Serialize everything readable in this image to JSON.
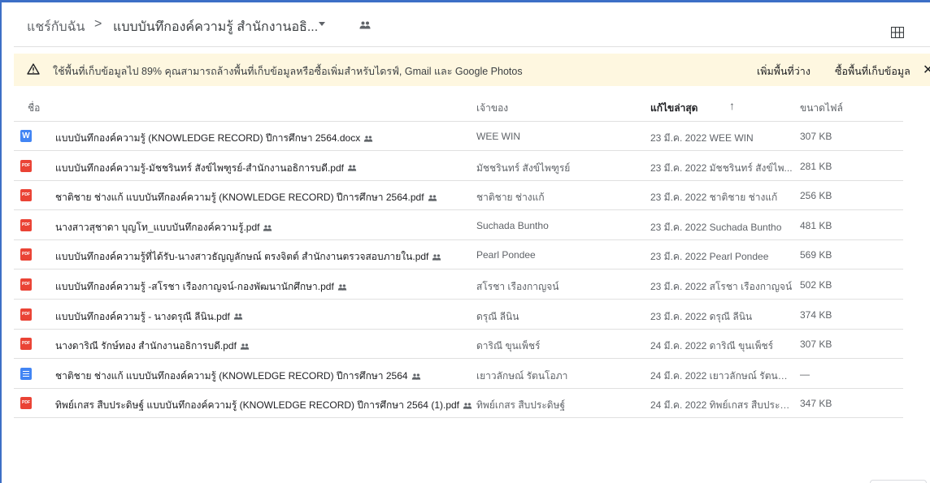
{
  "breadcrumb": {
    "root": "แชร์กับฉัน",
    "separator": ">",
    "current": "แบบบันทึกองค์ความรู้ สำนักงานอธิ..."
  },
  "banner": {
    "icon": "warning-icon",
    "text": "ใช้พื้นที่เก็บข้อมูลไป 89% คุณสามารถล้างพื้นที่เก็บข้อมูลหรือซื้อเพิ่มสำหรับไดรฟ์, Gmail และ Google Photos",
    "free_up_label": "เพิ่มพื้นที่ว่าง",
    "buy_storage_label": "ซื้อพื้นที่เก็บข้อมูล",
    "close_glyph": "✕",
    "bg_color": "#fef7e0"
  },
  "columns": {
    "name": "ชื่อ",
    "owner": "เจ้าของ",
    "modified": "แก้ไขล่าสุด",
    "size": "ขนาดไฟล์",
    "sort_arrow": "↑"
  },
  "files": [
    {
      "type": "word",
      "name": "แบบบันทึกองค์ความรู้ (KNOWLEDGE RECORD) ปีการศึกษา 2564.docx",
      "owner": "WEE WIN",
      "modified": "23 มี.ค. 2022 WEE WIN",
      "size": "307 KB"
    },
    {
      "type": "pdf",
      "name": "แบบบันทึกองค์ความรู้-มัชชรินทร์ สังข์ไพฑูรย์-สำนักงานอธิการบดี.pdf",
      "owner": "มัชชรินทร์ สังข์ไพฑูรย์",
      "modified": "23 มี.ค. 2022 มัชชรินทร์ สังข์ไพ...",
      "size": "281 KB"
    },
    {
      "type": "pdf",
      "name": "ชาติชาย ช่างแก้ แบบบันทึกองค์ความรู้ (KNOWLEDGE RECORD) ปีการศึกษา 2564.pdf",
      "owner": "ชาติชาย ช่างแก้",
      "modified": "23 มี.ค. 2022 ชาติชาย ช่างแก้",
      "size": "256 KB"
    },
    {
      "type": "pdf",
      "name": "นางสาวสุชาดา บุญโท_แบบบันทึกองค์ความรู้.pdf",
      "owner": "Suchada Buntho",
      "modified": "23 มี.ค. 2022 Suchada Buntho",
      "size": "481 KB"
    },
    {
      "type": "pdf",
      "name": "แบบบันทึกองค์ความรู้ที่ได้รับ-นางสาวธัญญลักษณ์ ตรงจิตต์ สำนักงานตรวจสอบภายใน.pdf",
      "owner": "Pearl Pondee",
      "modified": "23 มี.ค. 2022 Pearl Pondee",
      "size": "569 KB"
    },
    {
      "type": "pdf",
      "name": "แบบบันทึกองค์ความรู้ -สโรชา เรืองกาญจน์-กองพัฒนานักศึกษา.pdf",
      "owner": "สโรชา เรืองกาญจน์",
      "modified": "23 มี.ค. 2022 สโรชา เรืองกาญจน์",
      "size": "502 KB"
    },
    {
      "type": "pdf",
      "name": "แบบบันทึกองค์ความรู้ - นางดรุณี ลีนิน.pdf",
      "owner": "ดรุณี ลีนิน",
      "modified": "23 มี.ค. 2022 ดรุณี ลีนิน",
      "size": "374 KB"
    },
    {
      "type": "pdf",
      "name": "นางดาริณี รักษ์ทอง สำนักงานอธิการบดี.pdf",
      "owner": "ดาริณี ขุนเพ็ชร์",
      "modified": "24 มี.ค. 2022 ดาริณี ขุนเพ็ชร์",
      "size": "307 KB"
    },
    {
      "type": "doc",
      "name": "ชาติชาย ช่างแก้ แบบบันทึกองค์ความรู้ (KNOWLEDGE RECORD) ปีการศึกษา 2564",
      "owner": "เยาวลักษณ์ รัตนโอภา",
      "modified": "24 มี.ค. 2022 เยาวลักษณ์ รัตนโอ...",
      "size": "—"
    },
    {
      "type": "pdf",
      "name": "ทิพย์เกสร สืบประดิษฐ์ แบบบันทึกองค์ความรู้ (KNOWLEDGE RECORD) ปีการศึกษา 2564 (1).pdf",
      "owner": "ทิพย์เกสร สืบประดิษฐ์",
      "modified": "24 มี.ค. 2022 ทิพย์เกสร สืบประดิ...",
      "size": "347 KB"
    }
  ],
  "icons": {
    "shared": "shared-people-icon",
    "grid": "grid-view-icon",
    "pdf_label": "PDF",
    "word_label": "W"
  },
  "colors": {
    "frame": "#3d6fc6",
    "pdf": "#ea4335",
    "docs": "#4285f4"
  }
}
